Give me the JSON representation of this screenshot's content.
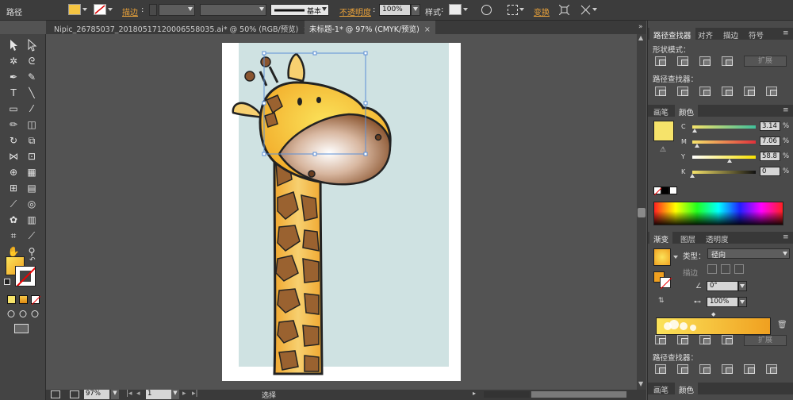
{
  "control_bar": {
    "object_type": "路径",
    "stroke_label": "描边",
    "stroke_style": "基本",
    "opacity_label": "不透明度",
    "opacity_value": "100%",
    "style_label": "样式",
    "transform_label": "变换"
  },
  "tabs": [
    {
      "label": "Nipic_26785037_20180517120006558035.ai* @ 50% (RGB/预览)",
      "close": "×"
    },
    {
      "label": "未标题-1* @ 97% (CMYK/预览)",
      "close": "×"
    }
  ],
  "status_bar": {
    "zoom": "97%",
    "page": "1",
    "tool": "选择"
  },
  "pathfinder_panel": {
    "tabs": [
      "路径查找器",
      "对齐",
      "描边",
      "符号"
    ],
    "shape_modes_label": "形状模式：",
    "expand_label": "扩展",
    "pathfinders_label": "路径查找器："
  },
  "color_panel": {
    "tabs": [
      "画笔",
      "颜色"
    ],
    "channels": [
      {
        "name": "C",
        "value": "3.14",
        "unit": "%",
        "level": 0.0314
      },
      {
        "name": "M",
        "value": "7.06",
        "unit": "%",
        "level": 0.0706
      },
      {
        "name": "Y",
        "value": "58.8",
        "unit": "%",
        "level": 0.588
      },
      {
        "name": "K",
        "value": "0",
        "unit": "%",
        "level": 0
      }
    ],
    "fill_color": "#f6e36a"
  },
  "gradient_panel": {
    "tabs": [
      "渐变",
      "图层",
      "透明度"
    ],
    "type_label": "类型：",
    "type_value": "径向",
    "stroke_label": "描边",
    "angle_value": "0°",
    "aspect_value": "100%",
    "expand_label": "扩展",
    "pathfinders_label": "路径查找器："
  },
  "bottom_panel": {
    "tabs": [
      "画笔",
      "颜色"
    ]
  },
  "colors": {
    "gradient_start": "#fbe35a",
    "gradient_end": "#f0a020",
    "accent_orange": "#e8a13a"
  }
}
